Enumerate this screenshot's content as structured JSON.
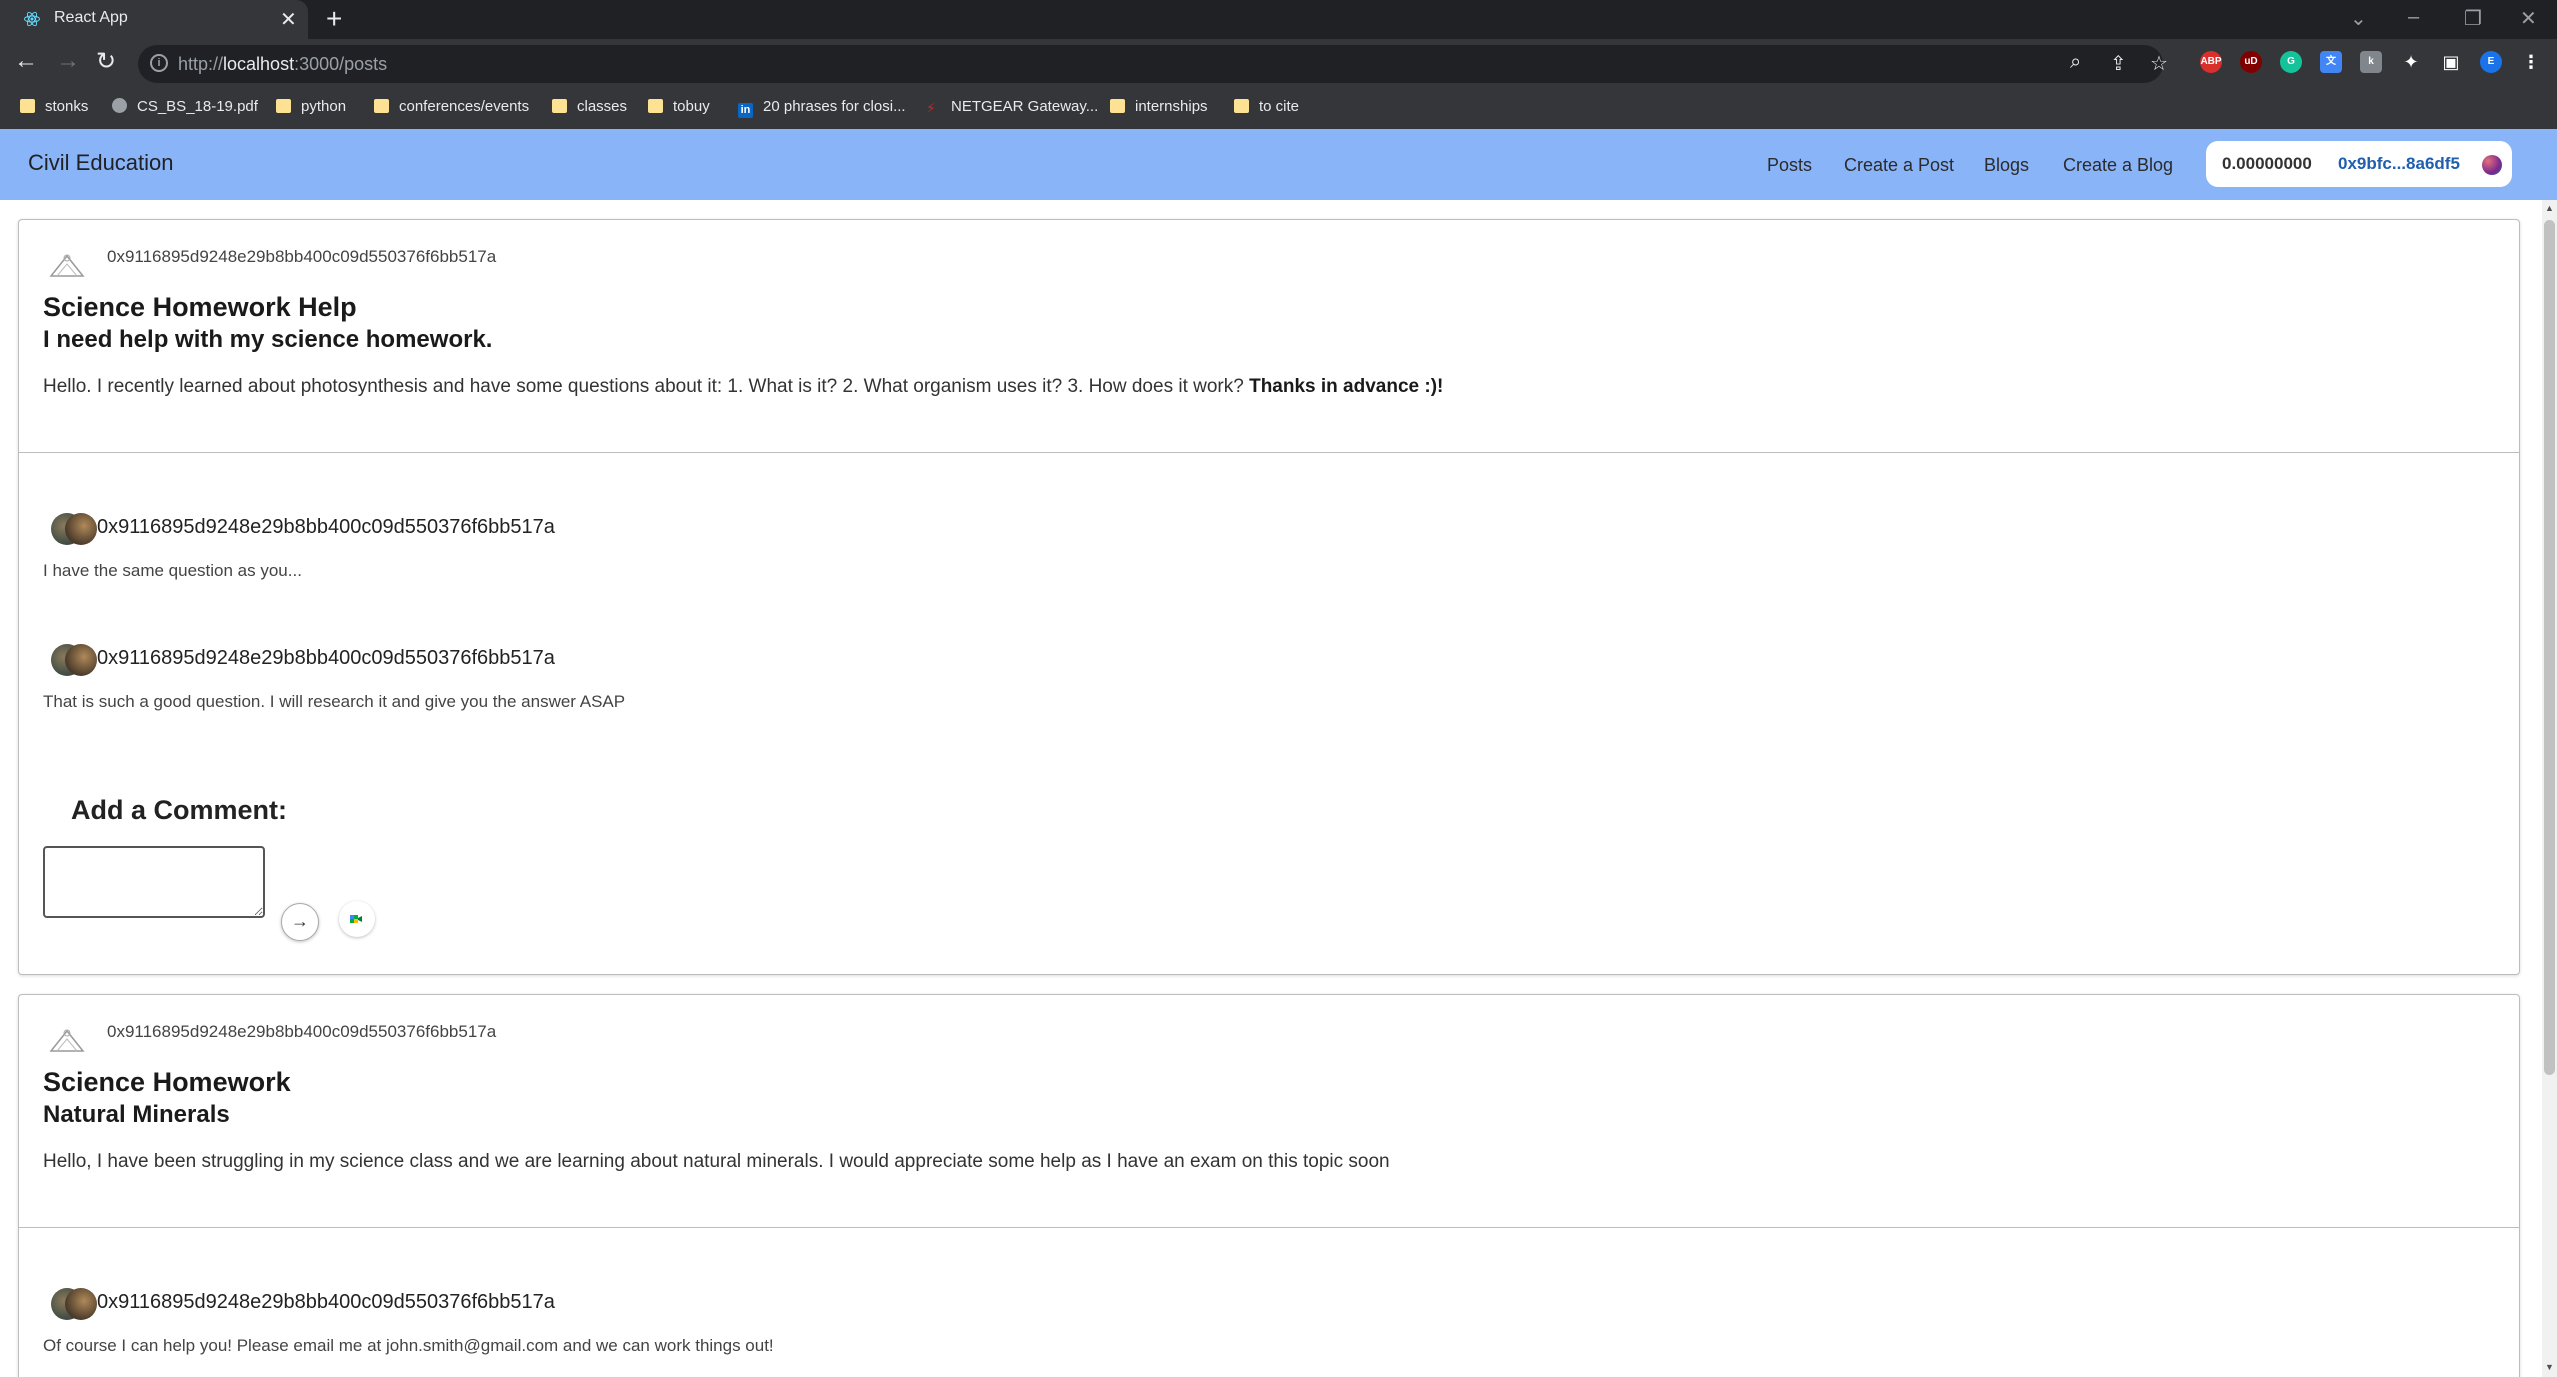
{
  "browser": {
    "tab_title": "React App",
    "new_tab_symbol": "+",
    "url_prefix": "http://",
    "url_host": "localhost",
    "url_path": ":3000/posts",
    "bookmarks": [
      {
        "label": "stonks",
        "icon": "folder"
      },
      {
        "label": "CS_BS_18-19.pdf",
        "icon": "globe"
      },
      {
        "label": "python",
        "icon": "folder"
      },
      {
        "label": "conferences/events",
        "icon": "folder"
      },
      {
        "label": "classes",
        "icon": "folder"
      },
      {
        "label": "tobuy",
        "icon": "folder"
      },
      {
        "label": "20 phrases for closi...",
        "icon": "linkedin"
      },
      {
        "label": "NETGEAR Gateway...",
        "icon": "netgear"
      },
      {
        "label": "internships",
        "icon": "folder"
      },
      {
        "label": "to cite",
        "icon": "folder"
      }
    ],
    "extensions": {
      "abp": "ABP",
      "ub": "uD",
      "grammarly": "G",
      "profile": "E"
    }
  },
  "app": {
    "brand": "Civil Education",
    "nav": {
      "posts": "Posts",
      "create_post": "Create a Post",
      "blogs": "Blogs",
      "create_blog": "Create a Blog"
    },
    "wallet": {
      "balance": "0.00000000",
      "address": "0x9bfc...8a6df5"
    }
  },
  "posts": [
    {
      "author": "0x9116895d9248e29b8bb400c09d550376f6bb517a",
      "title": "Science Homework Help",
      "subtitle": "I need help with my science homework.",
      "body": "Hello. I recently learned about photosynthesis and have some questions about it: 1. What is it? 2. What organism uses it? 3. How does it work? ",
      "body_bold": "Thanks in advance :)!",
      "comments": [
        {
          "author": "0x9116895d9248e29b8bb400c09d550376f6bb517a",
          "text": "I have the same question as you..."
        },
        {
          "author": "0x9116895d9248e29b8bb400c09d550376f6bb517a",
          "text": "That is such a good question. I will research it and give you the answer ASAP"
        }
      ],
      "add_comment_label": "Add a Comment:",
      "comment_value": "",
      "send_symbol": "→"
    },
    {
      "author": "0x9116895d9248e29b8bb400c09d550376f6bb517a",
      "title": "Science Homework",
      "subtitle": "Natural Minerals",
      "body": "Hello, I have been struggling in my science class and we are learning about natural minerals. I would appreciate some help as I have an exam on this topic soon",
      "comments": [
        {
          "author": "0x9116895d9248e29b8bb400c09d550376f6bb517a",
          "text": "Of course I can help you! Please email me at john.smith@gmail.com and we can work things out!"
        }
      ]
    }
  ],
  "colors": {
    "navbar": "#8ab4f8",
    "wallet_address": "#1f5fae"
  }
}
